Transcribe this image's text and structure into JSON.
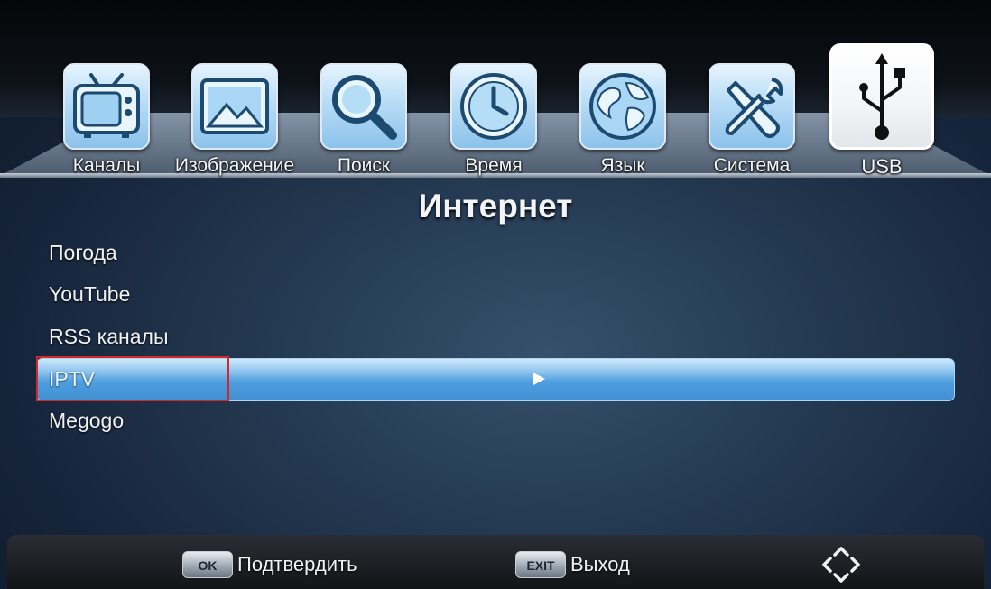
{
  "tabs": [
    {
      "label": "Каналы",
      "icon": "tv-icon"
    },
    {
      "label": "Изображение",
      "icon": "image-icon"
    },
    {
      "label": "Поиск",
      "icon": "search-icon"
    },
    {
      "label": "Время",
      "icon": "clock-icon"
    },
    {
      "label": "Язык",
      "icon": "globe-icon"
    },
    {
      "label": "Система",
      "icon": "tools-icon"
    },
    {
      "label": "USB",
      "icon": "usb-icon",
      "active": true
    }
  ],
  "page": {
    "title": "Интернет"
  },
  "menu": {
    "items": [
      {
        "label": "Погода"
      },
      {
        "label": "YouTube"
      },
      {
        "label": "RSS каналы"
      },
      {
        "label": "IPTV",
        "selected": true
      },
      {
        "label": "Megogo"
      }
    ]
  },
  "help": {
    "ok_key": "OK",
    "ok_label": "Подтвердить",
    "exit_key": "EXIT",
    "exit_label": "Выход",
    "nav_icon": "dpad-navigation-icon"
  },
  "colors": {
    "highlight": "#4f9fdf",
    "focus_outline": "#d42828",
    "tab_icon_bg": "#b8dcf6",
    "background": "#243a52"
  }
}
